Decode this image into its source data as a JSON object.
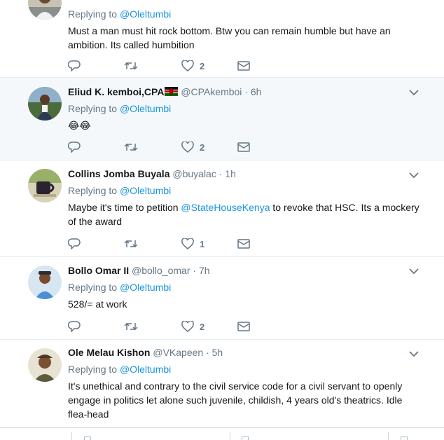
{
  "tweets": [
    {
      "name": "",
      "handle": "",
      "time": "",
      "replying_prefix": "Replying to",
      "replying_to": "@Oleltumbi",
      "text": "Must a man must hit rock bottom. Btw you can remain humble but have an ambition. Its called humbition",
      "likes": "2"
    },
    {
      "name": "Eliud K. kemboi,CPA",
      "handle": "@CPAkemboi",
      "time": "6h",
      "replying_prefix": "Replying to",
      "replying_to": "@Oleltumbi",
      "text": "😂😂",
      "likes": "2"
    },
    {
      "name": "Collins Jomba Buyala",
      "handle": "@buyalac",
      "time": "1h",
      "replying_prefix": "Replying to",
      "replying_to": "@Oleltumbi",
      "text_before": "Maybe it's time to petition ",
      "text_mention": "@StateHouseKenya",
      "text_after": " to revoke that HSC. Its a mockery of the award",
      "likes": "1"
    },
    {
      "name": "Bollo Omar II",
      "handle": "@bollo_omar",
      "time": "7h",
      "replying_prefix": "Replying to",
      "replying_to": "@Oleltumbi",
      "text": "528/= at work",
      "likes": "2"
    },
    {
      "name": "Ole Melau Kishon",
      "handle": "@VKapeen",
      "time": "5h",
      "replying_prefix": "Replying to",
      "replying_to": "@Oleltumbi",
      "text": "It's unethical and contrary to the civil service code for a civil servant to openly engage in politics let alone such juvenile, childish, 4 years old's theatrics. Idle flea-head"
    }
  ],
  "icons": {
    "reply": "reply-icon",
    "retweet": "retweet-icon",
    "like": "heart-icon",
    "dm": "envelope-icon",
    "more": "chevron-down-icon"
  },
  "colors": {
    "link": "#1b95e0",
    "muted": "#657786",
    "highlight_bg": "#f5f8fa",
    "border": "#e6ecf0",
    "flag_green": "#006600",
    "flag_red": "#bb0000"
  }
}
